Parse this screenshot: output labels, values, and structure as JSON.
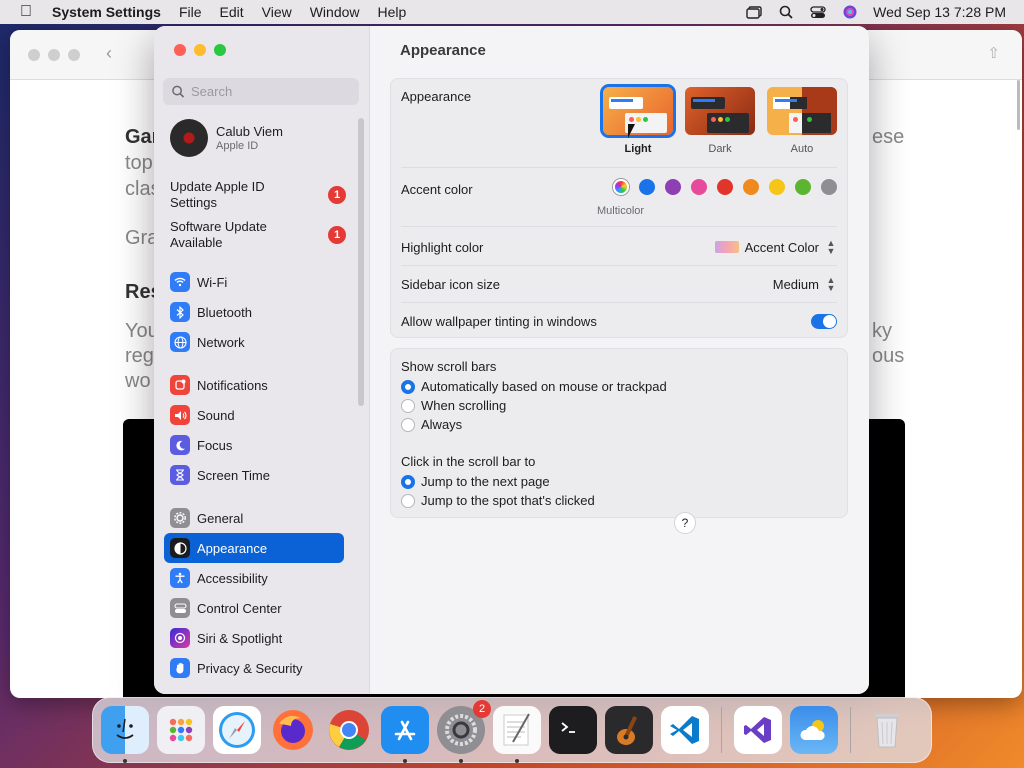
{
  "menubar": {
    "app_name": "System Settings",
    "menus": [
      "File",
      "Edit",
      "View",
      "Window",
      "Help"
    ],
    "datetime": "Wed Sep 13  7:28 PM"
  },
  "background_window": {
    "fragments": [
      "Gar",
      "top",
      "clas",
      "Gra",
      "Res",
      "You",
      "reg",
      "wo",
      "ese",
      "ky",
      "ous"
    ]
  },
  "sidebar": {
    "search_placeholder": "Search",
    "profile": {
      "name": "Calub Viem",
      "subtitle": "Apple ID"
    },
    "notices": [
      {
        "label": "Update Apple ID Settings",
        "badge": "1"
      },
      {
        "label": "Software Update Available",
        "badge": "1"
      }
    ],
    "items": [
      {
        "label": "Wi-Fi",
        "icon": "wifi-icon",
        "color": "#2f7cf6"
      },
      {
        "label": "Bluetooth",
        "icon": "bluetooth-icon",
        "color": "#2f7cf6"
      },
      {
        "label": "Network",
        "icon": "globe-icon",
        "color": "#2f7cf6"
      },
      {
        "label": "Notifications",
        "icon": "bell-icon",
        "color": "#f0443a"
      },
      {
        "label": "Sound",
        "icon": "speaker-icon",
        "color": "#f0443a"
      },
      {
        "label": "Focus",
        "icon": "moon-icon",
        "color": "#5c5ce0"
      },
      {
        "label": "Screen Time",
        "icon": "hourglass-icon",
        "color": "#5c5ce0"
      },
      {
        "label": "General",
        "icon": "gear-icon",
        "color": "#8e8e93"
      },
      {
        "label": "Appearance",
        "icon": "appearance-icon",
        "color": "#1c1c1e"
      },
      {
        "label": "Accessibility",
        "icon": "accessibility-icon",
        "color": "#2f7cf6"
      },
      {
        "label": "Control Center",
        "icon": "control-center-icon",
        "color": "#8e8e93"
      },
      {
        "label": "Siri & Spotlight",
        "icon": "siri-icon",
        "color": "#7b3fe4"
      },
      {
        "label": "Privacy & Security",
        "icon": "hand-icon",
        "color": "#2f7cf6"
      }
    ]
  },
  "content": {
    "title": "Appearance",
    "appearance_label": "Appearance",
    "appearance_options": [
      {
        "label": "Light",
        "selected": true
      },
      {
        "label": "Dark",
        "selected": false
      },
      {
        "label": "Auto",
        "selected": false
      }
    ],
    "accent_label": "Accent color",
    "accent_selected_label": "Multicolor",
    "accent_colors": [
      "multicolor",
      "#1a73e8",
      "#8e3fb3",
      "#e84a9b",
      "#e0352b",
      "#f08a1c",
      "#f5c518",
      "#5cb531",
      "#8e8e93"
    ],
    "highlight_label": "Highlight color",
    "highlight_value": "Accent Color",
    "icon_size_label": "Sidebar icon size",
    "icon_size_value": "Medium",
    "wallpaper_tint_label": "Allow wallpaper tinting in windows",
    "wallpaper_tint_on": true,
    "scroll_bars_label": "Show scroll bars",
    "scroll_bars_options": [
      "Automatically based on mouse or trackpad",
      "When scrolling",
      "Always"
    ],
    "scroll_bars_selected": 0,
    "click_scroll_label": "Click in the scroll bar to",
    "click_scroll_options": [
      "Jump to the next page",
      "Jump to the spot that's clicked"
    ],
    "click_scroll_selected": 0,
    "help_label": "?"
  },
  "dock": {
    "apps": [
      {
        "name": "finder-icon",
        "running": true
      },
      {
        "name": "launchpad-icon",
        "running": false
      },
      {
        "name": "safari-icon",
        "running": false
      },
      {
        "name": "firefox-icon",
        "running": false
      },
      {
        "name": "chrome-icon",
        "running": false
      },
      {
        "name": "app-store-icon",
        "running": true
      },
      {
        "name": "system-settings-icon",
        "running": true,
        "badge": "2"
      },
      {
        "name": "textedit-icon",
        "running": true
      },
      {
        "name": "terminal-icon",
        "running": false
      },
      {
        "name": "garageband-icon",
        "running": false
      },
      {
        "name": "vscode-icon",
        "running": false
      }
    ],
    "extra_apps": [
      "visual-studio-icon",
      "weather-icon"
    ],
    "trash": "trash-icon"
  }
}
